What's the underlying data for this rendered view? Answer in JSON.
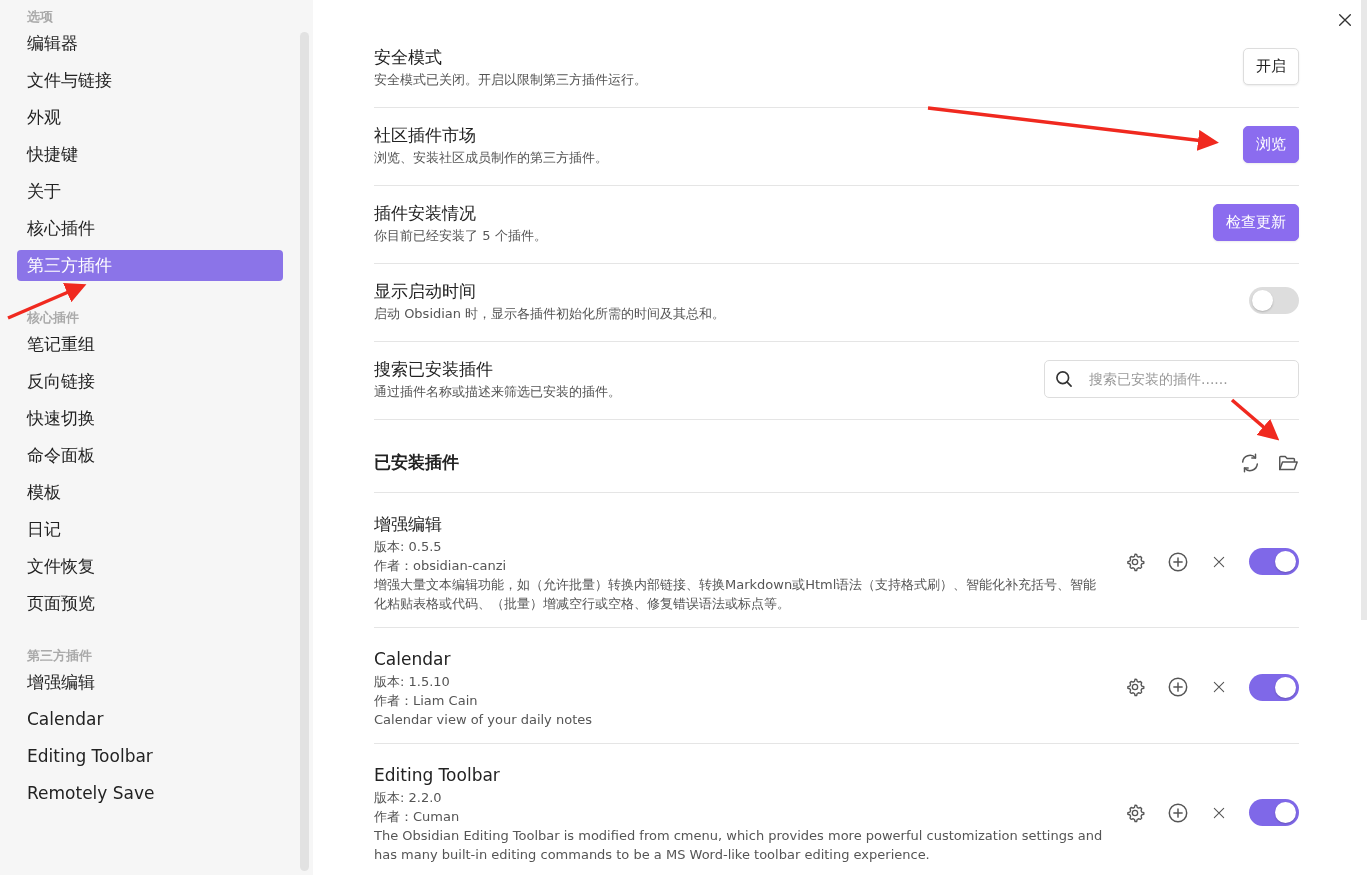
{
  "sidebar": {
    "sections": [
      {
        "heading": "选项",
        "items": [
          {
            "label": "编辑器",
            "selected": false
          },
          {
            "label": "文件与链接",
            "selected": false
          },
          {
            "label": "外观",
            "selected": false
          },
          {
            "label": "快捷键",
            "selected": false
          },
          {
            "label": "关于",
            "selected": false
          },
          {
            "label": "核心插件",
            "selected": false
          },
          {
            "label": "第三方插件",
            "selected": true
          }
        ]
      },
      {
        "heading": "核心插件",
        "items": [
          {
            "label": "笔记重组",
            "selected": false
          },
          {
            "label": "反向链接",
            "selected": false
          },
          {
            "label": "快速切换",
            "selected": false
          },
          {
            "label": "命令面板",
            "selected": false
          },
          {
            "label": "模板",
            "selected": false
          },
          {
            "label": "日记",
            "selected": false
          },
          {
            "label": "文件恢复",
            "selected": false
          },
          {
            "label": "页面预览",
            "selected": false
          }
        ]
      },
      {
        "heading": "第三方插件",
        "items": [
          {
            "label": "增强编辑",
            "selected": false
          },
          {
            "label": "Calendar",
            "selected": false
          },
          {
            "label": "Editing Toolbar",
            "selected": false
          },
          {
            "label": "Remotely Save",
            "selected": false
          }
        ]
      }
    ]
  },
  "settings": [
    {
      "title": "安全模式",
      "description": "安全模式已关闭。开启以限制第三方插件运行。",
      "control": {
        "kind": "button",
        "label": "开启",
        "primary": false
      }
    },
    {
      "title": "社区插件市场",
      "description": "浏览、安装社区成员制作的第三方插件。",
      "control": {
        "kind": "button",
        "label": "浏览",
        "primary": true
      }
    },
    {
      "title": "插件安装情况",
      "description": "你目前已经安装了 5 个插件。",
      "control": {
        "kind": "button",
        "label": "检查更新",
        "primary": true
      }
    },
    {
      "title": "显示启动时间",
      "description": "启动 Obsidian 时，显示各插件初始化所需的时间及其总和。",
      "control": {
        "kind": "toggle",
        "on": false
      }
    },
    {
      "title": "搜索已安装插件",
      "description": "通过插件名称或描述来筛选已安装的插件。",
      "control": {
        "kind": "search",
        "placeholder": "搜索已安装的插件......"
      }
    }
  ],
  "installed": {
    "heading": "已安装插件",
    "plugins": [
      {
        "name": "增强编辑",
        "version": "版本: 0.5.5",
        "author": "作者：obsidian-canzi",
        "description": "增强大量文本编辑功能，如（允许批量）转换内部链接、转换Markdown或Html语法（支持格式刷）、智能化补充括号、智能化粘贴表格或代码、（批量）增减空行或空格、修复错误语法或标点等。",
        "enabled": true
      },
      {
        "name": "Calendar",
        "version": "版本: 1.5.10",
        "author": "作者：Liam Cain",
        "description": "Calendar view of your daily notes",
        "enabled": true
      },
      {
        "name": "Editing Toolbar",
        "version": "版本: 2.2.0",
        "author": "作者：Cuman",
        "description": "The Obsidian Editing Toolbar is modified from cmenu, which provides more powerful customization settings and has many built-in editing commands to be a MS Word-like toolbar editing experience.",
        "enabled": true
      }
    ]
  }
}
